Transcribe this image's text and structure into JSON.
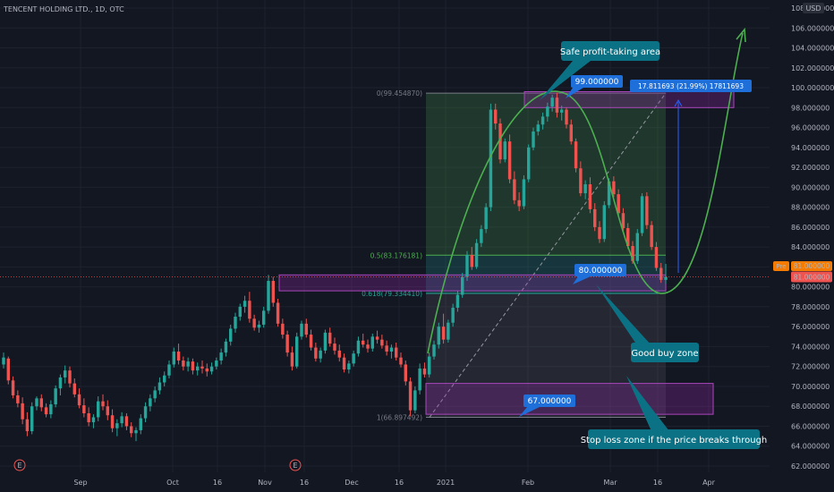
{
  "header": {
    "title": "TENCENT HOLDING LTD., 1D, OTC"
  },
  "currency_badge": "USD",
  "colors": {
    "background": "#131722",
    "grid": "#1e222d",
    "up": "#26a69a",
    "down": "#ef5350",
    "accent_blue": "#2962ff",
    "label_blue": "#1e6fd9",
    "callout_teal": "#0b7285",
    "zone_purple": "#9c27b0",
    "arc_green": "#4caf50",
    "price_orange": "#f57c00"
  },
  "price_axis": {
    "ticks": [
      "108.000000",
      "106.000000",
      "104.000000",
      "102.000000",
      "100.000000",
      "98.000000",
      "96.000000",
      "94.000000",
      "92.000000",
      "90.000000",
      "88.000000",
      "86.000000",
      "84.000000",
      "82.000000",
      "80.000000",
      "78.000000",
      "76.000000",
      "74.000000",
      "72.000000",
      "70.000000",
      "68.000000",
      "66.000000",
      "64.000000",
      "62.000000"
    ],
    "current_price_label": "81.000000",
    "prev_tag": "Pre",
    "prev_price_label": "81.000000",
    "current_price": 81.0
  },
  "time_axis": {
    "labels": [
      "Sep",
      "16",
      "Oct",
      "16",
      "Nov",
      "Dec",
      "16",
      "2021",
      "Feb",
      "Mar",
      "16",
      "Apr"
    ]
  },
  "event_markers": [
    "E",
    "E"
  ],
  "fib_labels": {
    "level_0": "0(99.454870)",
    "level_05": "0.5(83.176181)",
    "level_0618": "0.618(79.334410)",
    "level_1": "1(66.897492)"
  },
  "levels": {
    "fib_0": 99.45487,
    "fib_05": 83.176181,
    "fib_0618": 79.33441,
    "fib_1": 66.897492,
    "profit_zone_low": 98.0,
    "profit_zone_high": 99.6,
    "buy_zone_low": 79.6,
    "buy_zone_high": 81.2,
    "stop_zone_low": 67.2,
    "stop_zone_high": 70.3
  },
  "price_labels": {
    "top": "99.000000",
    "mid": "80.000000",
    "bottom": "67.000000"
  },
  "measure_label": "17.811693 (21.99%) 17811693",
  "callouts": {
    "profit": "Safe profit-taking area",
    "buy": "Good buy zone",
    "stop": "Stop loss zone if the price breaks through"
  },
  "chart_data": {
    "type": "candlestick",
    "title": "TENCENT HOLDING LTD., 1D, OTC",
    "xlabel": "",
    "ylabel": "",
    "ylim": [
      61,
      109
    ],
    "x_labels": [
      "Sep",
      "16",
      "Oct",
      "16",
      "Nov",
      "Dec",
      "16",
      "2021",
      "Feb",
      "Mar",
      "16",
      "Apr"
    ],
    "series": [
      {
        "values_ohlc": [
          [
            72.2,
            73.4,
            71.8,
            72.9
          ],
          [
            72.8,
            73.0,
            70.2,
            70.6
          ],
          [
            70.6,
            71.0,
            68.8,
            69.1
          ],
          [
            69.1,
            69.6,
            67.9,
            68.3
          ],
          [
            68.3,
            68.9,
            66.2,
            66.7
          ],
          [
            66.7,
            67.4,
            65.0,
            65.5
          ],
          [
            65.5,
            68.4,
            65.2,
            68.0
          ],
          [
            68.0,
            69.0,
            67.6,
            68.8
          ],
          [
            68.8,
            69.2,
            67.5,
            67.9
          ],
          [
            67.9,
            68.3,
            66.9,
            67.2
          ],
          [
            67.2,
            68.6,
            66.8,
            68.2
          ],
          [
            68.2,
            70.1,
            67.9,
            69.8
          ],
          [
            69.8,
            71.2,
            69.1,
            70.9
          ],
          [
            70.9,
            72.1,
            70.3,
            71.6
          ],
          [
            71.6,
            72.0,
            69.9,
            70.3
          ],
          [
            70.3,
            70.8,
            68.9,
            69.2
          ],
          [
            69.2,
            69.8,
            67.8,
            68.1
          ],
          [
            68.1,
            68.8,
            66.9,
            67.3
          ],
          [
            67.3,
            67.9,
            66.0,
            66.4
          ],
          [
            66.4,
            67.2,
            65.8,
            66.9
          ],
          [
            66.9,
            69.0,
            66.5,
            68.5
          ],
          [
            68.5,
            69.2,
            67.6,
            68.0
          ],
          [
            68.0,
            68.6,
            66.6,
            67.1
          ],
          [
            67.1,
            67.7,
            65.4,
            65.8
          ],
          [
            65.8,
            66.7,
            65.0,
            66.3
          ],
          [
            66.3,
            67.4,
            65.9,
            67.0
          ],
          [
            67.0,
            67.3,
            65.6,
            66.0
          ],
          [
            66.0,
            66.4,
            64.9,
            65.3
          ],
          [
            65.3,
            65.9,
            64.5,
            65.6
          ],
          [
            65.6,
            67.2,
            65.2,
            66.8
          ],
          [
            66.8,
            68.4,
            66.4,
            68.0
          ],
          [
            68.0,
            69.2,
            67.5,
            68.8
          ],
          [
            68.8,
            70.0,
            68.4,
            69.6
          ],
          [
            69.6,
            70.9,
            69.2,
            70.4
          ],
          [
            70.4,
            71.5,
            70.0,
            71.1
          ],
          [
            71.1,
            72.6,
            70.8,
            72.2
          ],
          [
            72.2,
            73.9,
            71.9,
            73.5
          ],
          [
            73.5,
            74.3,
            72.2,
            72.6
          ],
          [
            72.6,
            73.0,
            71.6,
            72.0
          ],
          [
            72.0,
            72.9,
            71.5,
            72.5
          ],
          [
            72.5,
            72.8,
            71.2,
            71.6
          ],
          [
            71.6,
            72.4,
            71.1,
            72.0
          ],
          [
            72.0,
            72.6,
            71.3,
            71.8
          ],
          [
            71.8,
            72.3,
            71.0,
            71.5
          ],
          [
            71.5,
            72.4,
            71.2,
            72.0
          ],
          [
            72.0,
            72.9,
            71.7,
            72.6
          ],
          [
            72.6,
            73.8,
            72.2,
            73.4
          ],
          [
            73.4,
            74.8,
            73.0,
            74.5
          ],
          [
            74.5,
            76.2,
            74.1,
            75.8
          ],
          [
            75.8,
            77.4,
            75.4,
            77.0
          ],
          [
            77.0,
            78.3,
            76.6,
            78.0
          ],
          [
            78.0,
            79.1,
            77.4,
            78.6
          ],
          [
            78.6,
            79.5,
            76.4,
            76.8
          ],
          [
            76.8,
            77.2,
            75.6,
            75.9
          ],
          [
            75.9,
            76.6,
            75.4,
            76.2
          ],
          [
            76.2,
            78.0,
            75.9,
            77.6
          ],
          [
            77.6,
            81.2,
            77.3,
            80.6
          ],
          [
            80.6,
            81.0,
            78.0,
            78.4
          ],
          [
            78.4,
            78.8,
            76.0,
            76.3
          ],
          [
            76.3,
            76.8,
            74.8,
            75.2
          ],
          [
            75.2,
            75.6,
            73.0,
            73.4
          ],
          [
            73.4,
            74.0,
            71.6,
            72.0
          ],
          [
            72.0,
            75.4,
            71.8,
            75.0
          ],
          [
            75.0,
            76.6,
            74.7,
            76.3
          ],
          [
            76.3,
            76.8,
            74.9,
            75.2
          ],
          [
            75.2,
            75.7,
            73.6,
            73.9
          ],
          [
            73.9,
            74.4,
            72.5,
            72.8
          ],
          [
            72.8,
            73.9,
            72.4,
            73.6
          ],
          [
            73.6,
            75.7,
            73.3,
            75.4
          ],
          [
            75.4,
            75.9,
            74.0,
            74.3
          ],
          [
            74.3,
            74.9,
            73.2,
            73.6
          ],
          [
            73.6,
            74.2,
            72.5,
            72.9
          ],
          [
            72.9,
            73.3,
            71.4,
            71.7
          ],
          [
            71.7,
            72.6,
            71.3,
            72.3
          ],
          [
            72.3,
            73.6,
            72.0,
            73.3
          ],
          [
            73.3,
            75.0,
            73.0,
            74.6
          ],
          [
            74.6,
            75.3,
            73.9,
            74.2
          ],
          [
            74.2,
            74.7,
            73.4,
            73.8
          ],
          [
            73.8,
            75.3,
            73.5,
            75.0
          ],
          [
            75.0,
            75.6,
            74.3,
            74.7
          ],
          [
            74.7,
            75.2,
            73.8,
            74.1
          ],
          [
            74.1,
            74.6,
            73.1,
            73.5
          ],
          [
            73.5,
            74.2,
            72.8,
            73.9
          ],
          [
            73.9,
            74.4,
            72.6,
            72.9
          ],
          [
            72.9,
            73.4,
            71.9,
            72.2
          ],
          [
            72.2,
            72.6,
            70.1,
            70.5
          ],
          [
            70.5,
            70.9,
            67.0,
            67.6
          ],
          [
            67.6,
            70.0,
            67.3,
            69.6
          ],
          [
            69.6,
            72.3,
            69.2,
            71.8
          ],
          [
            71.8,
            72.4,
            70.9,
            71.2
          ],
          [
            71.2,
            73.4,
            70.9,
            73.0
          ],
          [
            73.0,
            74.6,
            72.7,
            74.2
          ],
          [
            74.2,
            76.4,
            73.8,
            76.0
          ],
          [
            76.0,
            77.3,
            74.3,
            74.7
          ],
          [
            74.7,
            76.7,
            74.4,
            76.4
          ],
          [
            76.4,
            78.3,
            76.0,
            77.9
          ],
          [
            77.9,
            79.6,
            77.5,
            79.2
          ],
          [
            79.2,
            81.4,
            78.9,
            81.0
          ],
          [
            81.0,
            83.6,
            80.6,
            83.2
          ],
          [
            83.2,
            84.0,
            81.7,
            82.0
          ],
          [
            82.0,
            84.8,
            81.8,
            84.4
          ],
          [
            84.4,
            86.2,
            84.0,
            85.8
          ],
          [
            85.8,
            88.4,
            85.4,
            88.0
          ],
          [
            88.0,
            98.4,
            87.6,
            97.8
          ],
          [
            97.8,
            98.4,
            95.8,
            96.4
          ],
          [
            96.4,
            96.9,
            92.4,
            92.8
          ],
          [
            92.8,
            94.9,
            92.5,
            94.6
          ],
          [
            94.6,
            95.3,
            90.4,
            90.8
          ],
          [
            90.8,
            91.6,
            88.3,
            88.7
          ],
          [
            88.7,
            89.5,
            87.6,
            88.1
          ],
          [
            88.1,
            91.2,
            87.8,
            90.8
          ],
          [
            90.8,
            94.3,
            90.5,
            94.0
          ],
          [
            94.0,
            96.0,
            93.7,
            95.6
          ],
          [
            95.6,
            96.7,
            95.2,
            96.3
          ],
          [
            96.3,
            97.5,
            95.8,
            97.1
          ],
          [
            97.1,
            98.5,
            96.6,
            98.1
          ],
          [
            98.1,
            99.3,
            97.6,
            99.0
          ],
          [
            99.0,
            99.5,
            97.0,
            97.5
          ],
          [
            97.5,
            98.2,
            96.7,
            97.8
          ],
          [
            97.8,
            98.0,
            95.9,
            96.3
          ],
          [
            96.3,
            96.8,
            94.3,
            94.6
          ],
          [
            94.6,
            94.9,
            91.5,
            91.9
          ],
          [
            91.9,
            92.6,
            89.1,
            89.4
          ],
          [
            89.4,
            90.7,
            88.8,
            90.3
          ],
          [
            90.3,
            91.0,
            87.4,
            87.8
          ],
          [
            87.8,
            88.4,
            85.6,
            86.0
          ],
          [
            86.0,
            86.6,
            84.4,
            84.8
          ],
          [
            84.8,
            88.6,
            84.5,
            88.2
          ],
          [
            88.2,
            90.9,
            87.9,
            90.6
          ],
          [
            90.6,
            91.1,
            89.0,
            89.3
          ],
          [
            89.3,
            89.8,
            87.1,
            87.4
          ],
          [
            87.4,
            87.9,
            85.6,
            85.9
          ],
          [
            85.9,
            86.4,
            83.8,
            84.1
          ],
          [
            84.1,
            84.6,
            82.3,
            82.6
          ],
          [
            82.6,
            85.8,
            82.3,
            85.4
          ],
          [
            85.4,
            89.4,
            85.1,
            89.1
          ],
          [
            89.1,
            89.5,
            85.8,
            86.2
          ],
          [
            86.2,
            86.6,
            83.7,
            84.0
          ],
          [
            84.0,
            84.5,
            81.6,
            81.9
          ],
          [
            81.9,
            82.4,
            80.4,
            80.7
          ],
          [
            80.7,
            82.3,
            80.3,
            81.0
          ]
        ]
      }
    ]
  }
}
